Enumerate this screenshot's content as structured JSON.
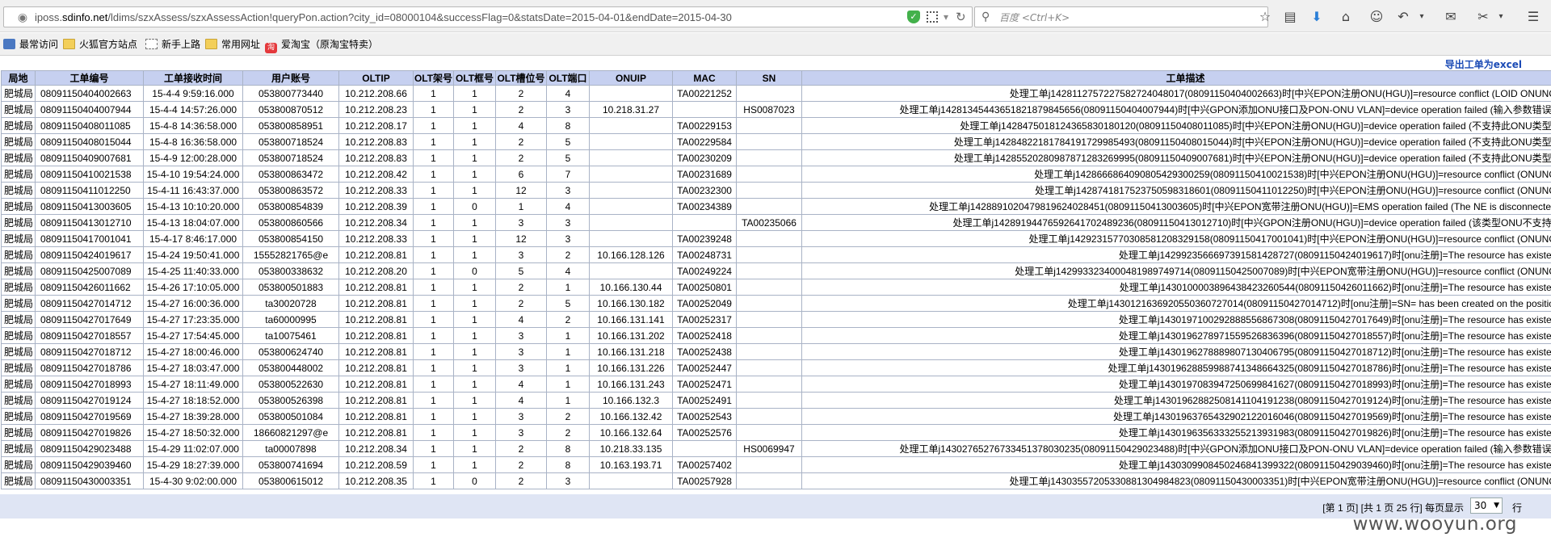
{
  "browser": {
    "url_prefix": "iposs.",
    "url_domain": "sdinfo.net",
    "url_path": "/ldims/szxAssess/szxAssessAction!queryPon.action?city_id=08000104&successFlag=0&statsDate=2015-04-01&endDate=2015-04-30",
    "search_placeholder": "百度 <Ctrl+K>"
  },
  "bookmarks": [
    {
      "label": "最常访问",
      "icon": "star-icon"
    },
    {
      "label": "火狐官方站点",
      "icon": "folder-icon"
    },
    {
      "label": "新手上路",
      "icon": "page-icon"
    },
    {
      "label": "常用网址",
      "icon": "folder-icon"
    },
    {
      "label": "爱淘宝（原淘宝特卖）",
      "icon": "taobao-icon"
    }
  ],
  "export_label": "导出工单为excel",
  "table": {
    "headers": [
      "局地",
      "工单编号",
      "工单接收时间",
      "用户账号",
      "OLTIP",
      "OLT架号",
      "OLT框号",
      "OLT槽位号",
      "OLT端口",
      "ONUIP",
      "MAC",
      "SN",
      "工单描述"
    ],
    "rows": [
      [
        "肥城局",
        "08091150404002663",
        "15-4-4 9:59:16.000",
        "053800773440",
        "10.212.208.66",
        "1",
        "1",
        "2",
        "4",
        "",
        "TA00221252",
        "",
        "处理工单j1428112757227582724048017(08091150404002663)时[中兴EPON注册ONU(HGU)]=resource conflict (LOID ONUNO);"
      ],
      [
        "肥城局",
        "08091150404007944",
        "15-4-4 14:57:26.000",
        "053800870512",
        "10.212.208.23",
        "1",
        "1",
        "2",
        "3",
        "10.218.31.27",
        "",
        "HS0087023",
        "处理工单j1428134544365182187984565​6(08091150404007944)时[中兴GPON添加ONU接口及PON-ONU VLAN]=device operation failed (输入参数错误。);"
      ],
      [
        "肥城局",
        "08091150408011085",
        "15-4-8 14:36:58.000",
        "053800858951",
        "10.212.208.17",
        "1",
        "1",
        "4",
        "8",
        "",
        "TA00229153",
        "",
        "处理工单j1428475018124365830180120(08091150408011085)时[中兴EPON注册ONU(HGU)]=device operation failed (不支持此ONU类型。);"
      ],
      [
        "肥城局",
        "08091150408015044",
        "15-4-8 16:36:58.000",
        "053800718524",
        "10.212.208.83",
        "1",
        "1",
        "2",
        "5",
        "",
        "TA00229584",
        "",
        "处理工单j1428482218178419172998549​3(08091150408015044)时[中兴EPON注册ONU(HGU)]=device operation failed (不支持此ONU类型。);"
      ],
      [
        "肥城局",
        "08091150409007681",
        "15-4-9 12:00:28.000",
        "053800718524",
        "10.212.208.83",
        "1",
        "1",
        "2",
        "5",
        "",
        "TA00230209",
        "",
        "处理工单j1428552028098787128326999​5(08091150409007681)时[中兴EPON注册ONU(HGU)]=device operation failed (不支持此ONU类型。);"
      ],
      [
        "肥城局",
        "08091150410021538",
        "15-4-10 19:54:24.000",
        "053800863472",
        "10.212.208.42",
        "1",
        "1",
        "6",
        "7",
        "",
        "TA00231689",
        "",
        "处理工单j1428666864090805429300259(08091150410021538)时[中兴EPON注册ONU(HGU)]=resource conflict (ONUNO);"
      ],
      [
        "肥城局",
        "08091150411012250",
        "15-4-11 16:43:37.000",
        "053800863572",
        "10.212.208.33",
        "1",
        "1",
        "12",
        "3",
        "",
        "TA00232300",
        "",
        "处理工单j1428741817523750598318601(08091150411012250)时[中兴EPON注册ONU(HGU)]=resource conflict (ONUNO);"
      ],
      [
        "肥城局",
        "08091150413003605",
        "15-4-13 10:10:20.000",
        "053800854839",
        "10.212.208.39",
        "1",
        "0",
        "1",
        "4",
        "",
        "TA00234389",
        "",
        "处理工单j1428891020479819624028451(08091150413003605)时[中兴EPON宽带注册ONU(HGU)]=EMS operation failed (The NE is disconnected);"
      ],
      [
        "肥城局",
        "08091150413012710",
        "15-4-13 18:04:07.000",
        "053800860566",
        "10.212.208.34",
        "1",
        "1",
        "3",
        "3",
        "",
        "",
        "TA00235066",
        "处理工单j1428919447659264170248923​6(08091150413012710)时[中兴GPON注册ONU(HGU)]=device operation failed (该类型ONU不支持。);"
      ],
      [
        "肥城局",
        "08091150417001041",
        "15-4-17 8:46:17.000",
        "053800854150",
        "10.212.208.33",
        "1",
        "1",
        "12",
        "3",
        "",
        "TA00239248",
        "",
        "处理工单j1429231577030858120832915​8(08091150417001041)时[中兴EPON注册ONU(HGU)]=resource conflict (ONUNO);"
      ],
      [
        "肥城局",
        "08091150424019617",
        "15-4-24 19:50:41.000",
        "15552821765@e",
        "10.212.208.81",
        "1",
        "1",
        "3",
        "2",
        "10.166.128.126",
        "TA00248731",
        "",
        "处理工单j1429923566697391581428727(08091150424019617)时[onu注册]=The resource has existed.;"
      ],
      [
        "肥城局",
        "08091150425007089",
        "15-4-25 11:40:33.000",
        "053800338632",
        "10.212.208.20",
        "1",
        "0",
        "5",
        "4",
        "",
        "TA00249224",
        "",
        "处理工单j1429933234000481989749714(08091150425007089)时[中兴EPON宽带注册ONU(HGU)]=resource conflict (ONUNO);"
      ],
      [
        "肥城局",
        "08091150426011662",
        "15-4-26 17:10:05.000",
        "053800501883",
        "10.212.208.81",
        "1",
        "1",
        "2",
        "1",
        "10.166.130.44",
        "TA00250801",
        "",
        "处理工单j1430100003896438423260544(08091150426011662)时[onu注册]=The resource has existed.;"
      ],
      [
        "肥城局",
        "08091150427014712",
        "15-4-27 16:00:36.000",
        "ta30020728",
        "10.212.208.81",
        "1",
        "1",
        "2",
        "5",
        "10.166.130.182",
        "TA00252049",
        "",
        "处理工单j1430121636920550360727014(08091150427014712)时[onu注册]=SN= has been created on the position;"
      ],
      [
        "肥城局",
        "08091150427017649",
        "15-4-27 17:23:35.000",
        "ta60000995",
        "10.212.208.81",
        "1",
        "1",
        "4",
        "2",
        "10.166.131.141",
        "TA00252317",
        "",
        "处理工单j1430197100292888556867308(08091150427017649)时[onu注册]=The resource has existed.;"
      ],
      [
        "肥城局",
        "08091150427018557",
        "15-4-27 17:54:45.000",
        "ta10075461",
        "10.212.208.81",
        "1",
        "1",
        "3",
        "1",
        "10.166.131.202",
        "TA00252418",
        "",
        "处理工单j1430196278971559526836396(08091150427018557)时[onu注册]=The resource has existed.;"
      ],
      [
        "肥城局",
        "08091150427018712",
        "15-4-27 18:00:46.000",
        "053800624740",
        "10.212.208.81",
        "1",
        "1",
        "3",
        "1",
        "10.166.131.218",
        "TA00252438",
        "",
        "处理工单j1430196278889807130406795(08091150427018712)时[onu注册]=The resource has existed.;"
      ],
      [
        "肥城局",
        "08091150427018786",
        "15-4-27 18:03:47.000",
        "053800448002",
        "10.212.208.81",
        "1",
        "1",
        "3",
        "1",
        "10.166.131.226",
        "TA00252447",
        "",
        "处理工单j1430196288599887413486643​25(08091150427018786)时[onu注册]=The resource has existed.;"
      ],
      [
        "肥城局",
        "08091150427018993",
        "15-4-27 18:11:49.000",
        "053800522630",
        "10.212.208.81",
        "1",
        "1",
        "4",
        "1",
        "10.166.131.243",
        "TA00252471",
        "",
        "处理工单j1430197083947250699841627(08091150427018993)时[onu注册]=The resource has existed.;"
      ],
      [
        "肥城局",
        "08091150427019124",
        "15-4-27 18:18:52.000",
        "053800526398",
        "10.212.208.81",
        "1",
        "1",
        "4",
        "1",
        "10.166.132.3",
        "TA00252491",
        "",
        "处理工单j1430196288250814110419123​8(08091150427019124)时[onu注册]=The resource has existed.;"
      ],
      [
        "肥城局",
        "08091150427019569",
        "15-4-27 18:39:28.000",
        "053800501084",
        "10.212.208.81",
        "1",
        "1",
        "3",
        "2",
        "10.166.132.42",
        "TA00252543",
        "",
        "处理工单j1430196376543290212201604​6(08091150427019569)时[onu注册]=The resource has existed.;"
      ],
      [
        "肥城局",
        "08091150427019826",
        "15-4-27 18:50:32.000",
        "18660821297@e",
        "10.212.208.81",
        "1",
        "1",
        "3",
        "2",
        "10.166.132.64",
        "TA00252576",
        "",
        "处理工单j1430196356333255213931983(08091150427019826)时[onu注册]=The resource has existed.;"
      ],
      [
        "肥城局",
        "08091150429023488",
        "15-4-29 11:02:07.000",
        "ta00007898",
        "10.212.208.34",
        "1",
        "1",
        "2",
        "8",
        "10.218.33.135",
        "",
        "HS0069947",
        "处理工单j1430276527673345137803023​5(08091150429023488)时[中兴GPON添加ONU接口及PON-ONU VLAN]=device operation failed (输入参数错误。);"
      ],
      [
        "肥城局",
        "08091150429039460",
        "15-4-29 18:27:39.000",
        "053800741694",
        "10.212.208.59",
        "1",
        "1",
        "2",
        "8",
        "10.163.193.71",
        "TA00257402",
        "",
        "处理工单j1430309908450246841399322(08091150429039460)时[onu注册]=The resource has existed.;"
      ],
      [
        "肥城局",
        "08091150430003351",
        "15-4-30 9:02:00.000",
        "053800615012",
        "10.212.208.35",
        "1",
        "0",
        "2",
        "3",
        "",
        "TA00257928",
        "",
        "处理工单j1430355720533088130498482​3(08091150430003351)时[中兴EPON宽带注册ONU(HGU)]=resource conflict (ONUNO);"
      ]
    ]
  },
  "pager": {
    "text": "[第 1 页] [共 1 页 25 行] 每页显示",
    "per_page": "30",
    "suffix": "行"
  },
  "watermark": "www.wooyun.org"
}
